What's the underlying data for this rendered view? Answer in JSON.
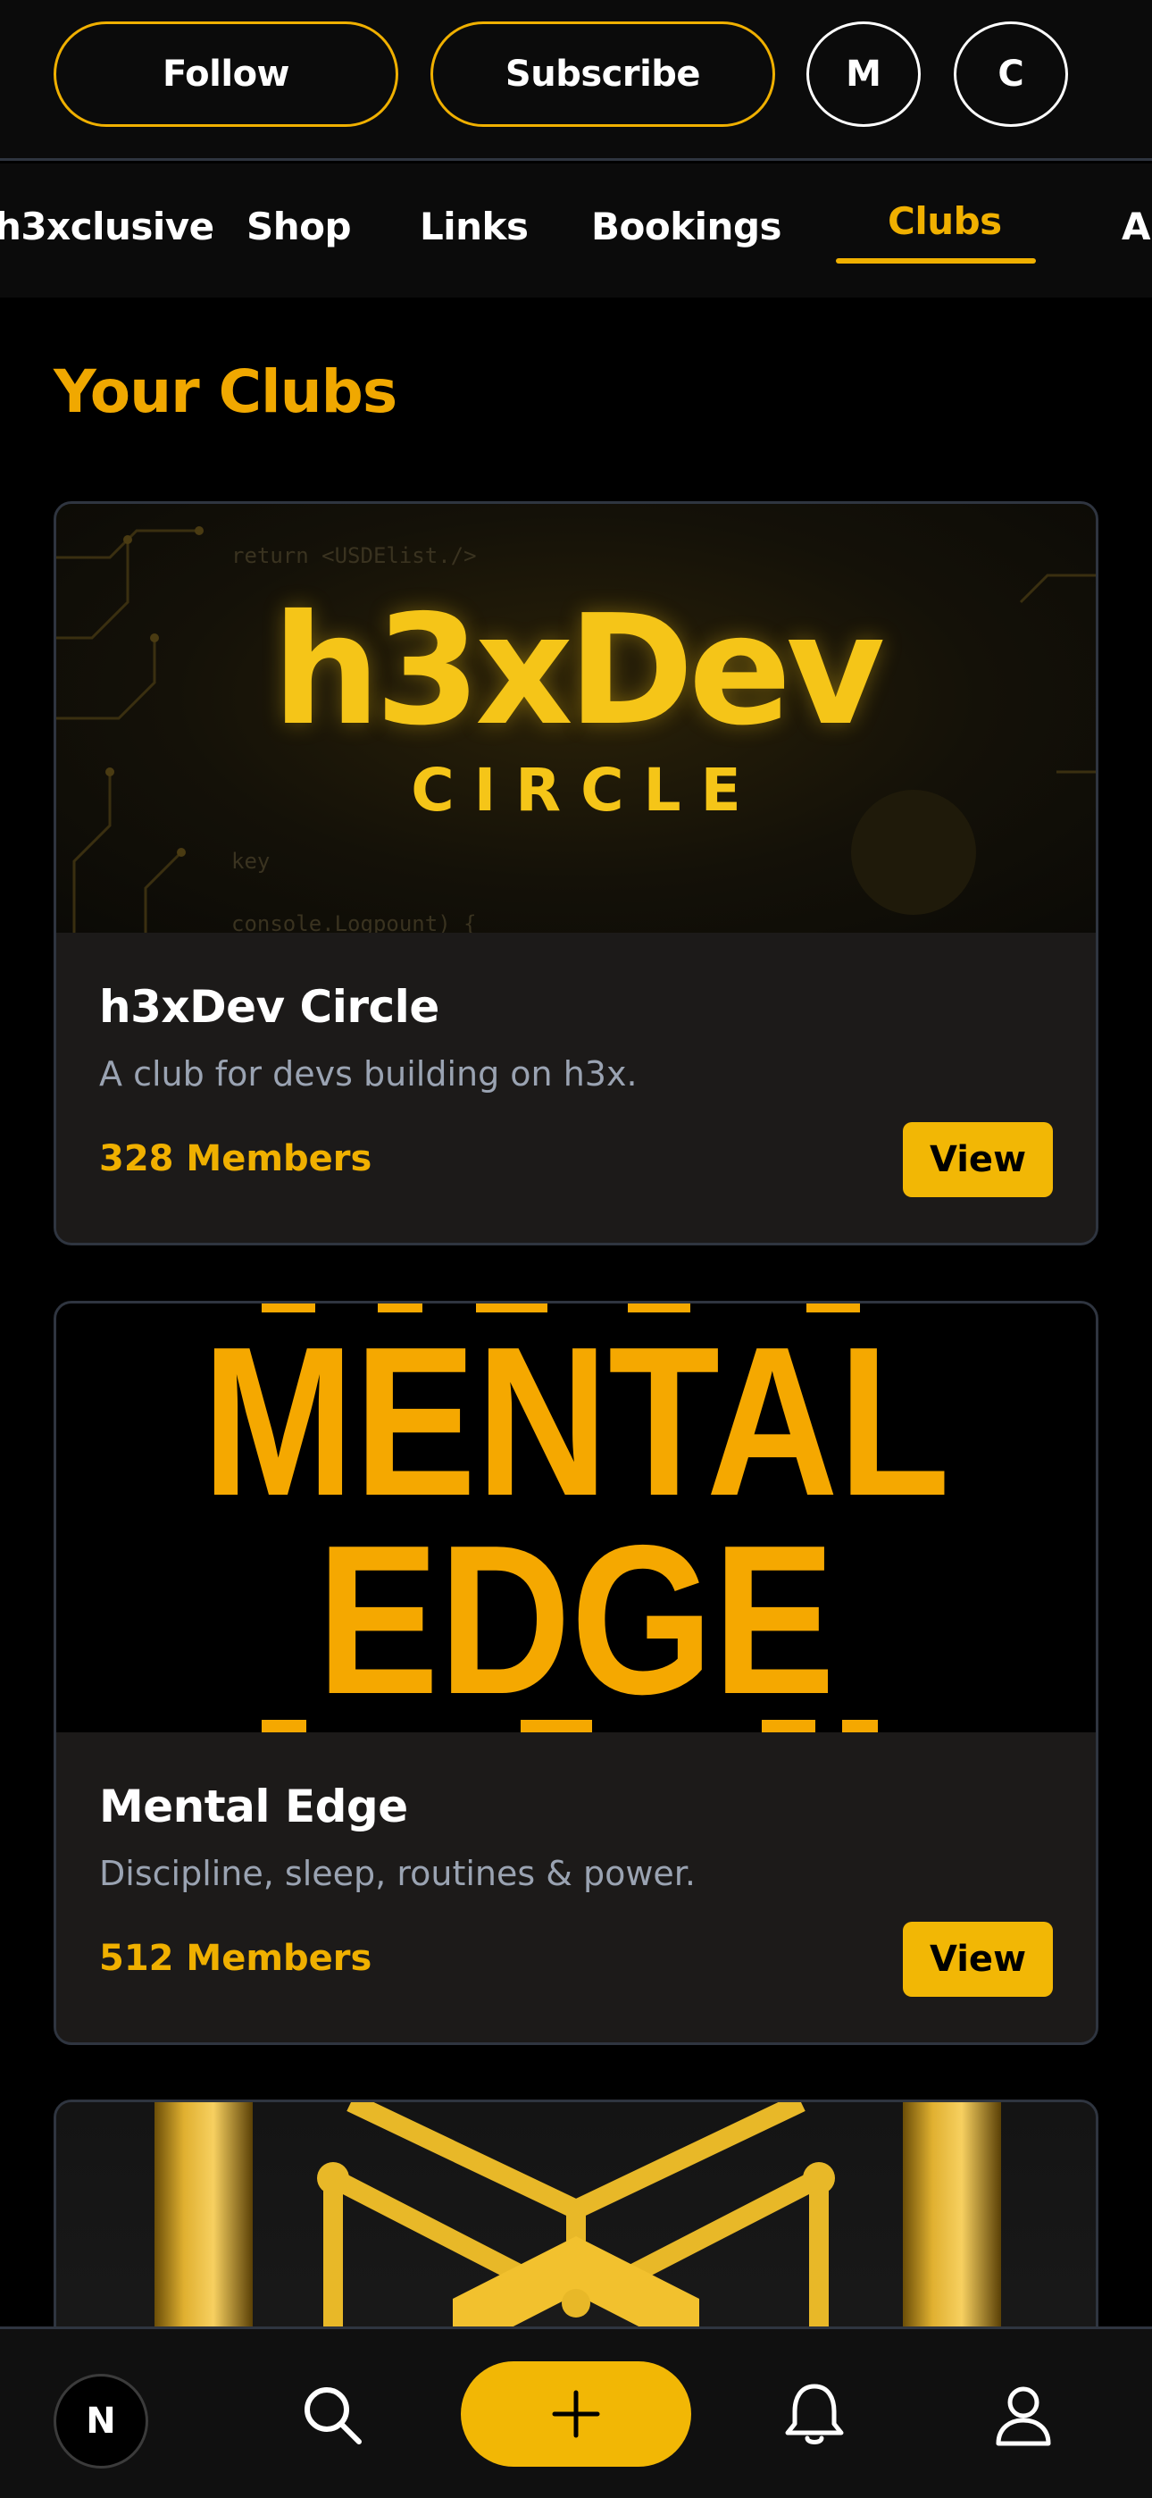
{
  "header": {
    "follow_label": "Follow",
    "subscribe_label": "Subscribe",
    "circle_m": "M",
    "circle_c": "C"
  },
  "tabs": [
    {
      "label": "h3xclusive"
    },
    {
      "label": "Shop"
    },
    {
      "label": "Links"
    },
    {
      "label": "Bookings"
    },
    {
      "label": "Clubs",
      "active": true
    },
    {
      "label": "Al"
    }
  ],
  "section_title": "Your Clubs",
  "clubs": [
    {
      "name": "h3xDev Circle",
      "description": "A club for devs building on h3x.",
      "members": "328 Members",
      "view_label": "View",
      "image": {
        "logo": "h3xDev",
        "subtitle": "CIRCLE",
        "code_lines": [
          "return <USDElist./>",
          "key",
          "console.Logpount) {"
        ]
      }
    },
    {
      "name": "Mental Edge",
      "description": "Discipline, sleep, routines & power.",
      "members": "512 Members",
      "view_label": "View",
      "image": {
        "line1": "MENTAL",
        "line2": "EDGE"
      }
    },
    {
      "image": {
        "icon": "gold-cube-icon"
      }
    }
  ],
  "bottom_nav": {
    "avatar_letter": "N",
    "icons": [
      "search-icon",
      "plus-icon",
      "bell-icon",
      "user-icon"
    ]
  },
  "colors": {
    "accent": "#f0b000",
    "background": "#000000",
    "card": "#1c1a19",
    "muted_text": "#9aa3b2",
    "border": "#2f3540"
  }
}
